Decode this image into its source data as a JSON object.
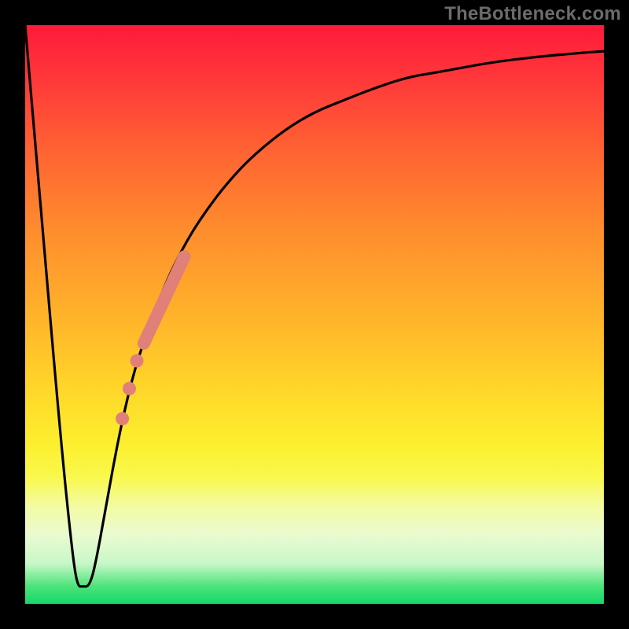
{
  "watermark": "TheBottleneck.com",
  "colors": {
    "frame": "#000000",
    "curve": "#000000",
    "marker": "#e08078",
    "gradient_top": "#ff1a3a",
    "gradient_bottom": "#14d86a"
  },
  "chart_data": {
    "type": "line",
    "title": "",
    "xlabel": "",
    "ylabel": "",
    "xlim": [
      0,
      100
    ],
    "ylim": [
      0,
      100
    ],
    "grid": false,
    "legend": false,
    "background": "vertical-gradient red→orange→yellow→green",
    "series": [
      {
        "name": "bottleneck-curve",
        "x": [
          0,
          3,
          6,
          8,
          9,
          10,
          11,
          12,
          14,
          16,
          18,
          20,
          24,
          28,
          32,
          36,
          40,
          45,
          50,
          55,
          60,
          66,
          72,
          80,
          88,
          96,
          100
        ],
        "y": [
          100,
          65,
          30,
          10,
          3,
          3,
          3,
          6,
          17,
          28,
          37,
          44,
          55,
          63,
          69,
          74,
          78,
          82,
          85,
          87,
          89,
          91,
          92,
          93.5,
          94.5,
          95.2,
          95.5
        ]
      }
    ],
    "markers": [
      {
        "name": "highlight-segment",
        "shape": "thick-rounded-line",
        "color": "#e08078",
        "x": [
          20.5,
          27.5
        ],
        "y": [
          45,
          60
        ]
      },
      {
        "name": "highlight-dot-1",
        "shape": "circle",
        "color": "#e08078",
        "x": 19.3,
        "y": 42.0
      },
      {
        "name": "highlight-dot-2",
        "shape": "circle",
        "color": "#e08078",
        "x": 18.0,
        "y": 37.2
      },
      {
        "name": "highlight-dot-3",
        "shape": "circle",
        "color": "#e08078",
        "x": 16.8,
        "y": 32.0
      }
    ]
  }
}
